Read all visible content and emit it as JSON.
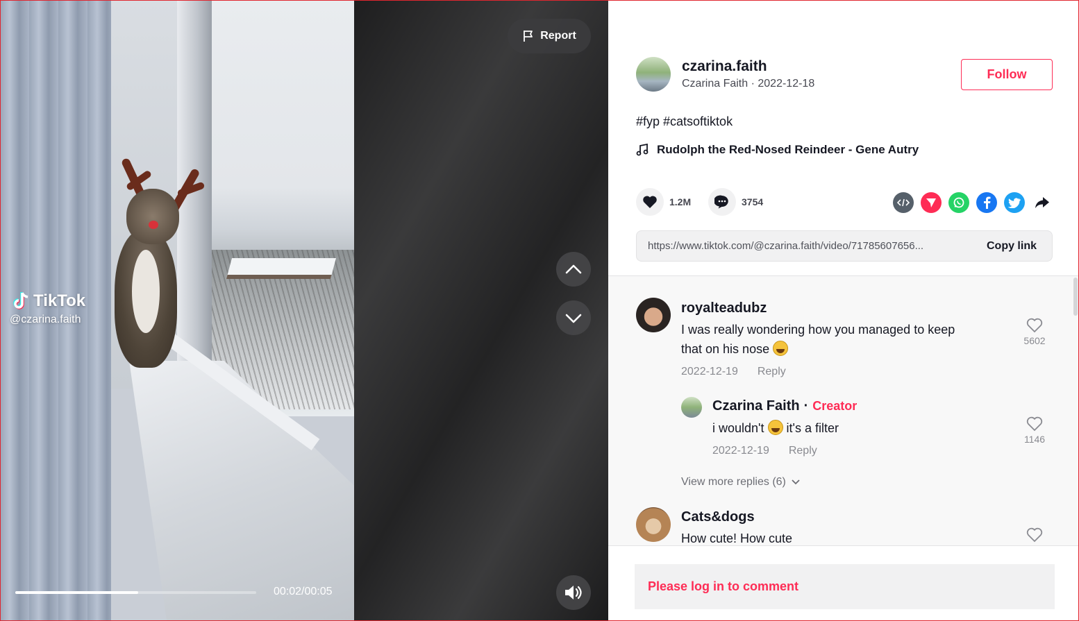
{
  "video": {
    "watermark_brand": "TikTok",
    "watermark_user": "@czarina.faith",
    "time": "00:02/00:05",
    "progress": 0.51
  },
  "controls": {
    "report_label": "Report"
  },
  "author": {
    "username": "czarina.faith",
    "subtitle": "Czarina Faith · 2022-12-18",
    "follow_label": "Follow"
  },
  "post": {
    "description": "#fyp #catsoftiktok",
    "music": "Rudolph the Red-Nosed Reindeer - Gene Autry"
  },
  "stats": {
    "likes": "1.2M",
    "comments": "3754"
  },
  "share": {
    "icons": [
      "embed-icon",
      "send-icon",
      "whatsapp-icon",
      "facebook-icon",
      "twitter-icon",
      "share-arrow-icon"
    ],
    "colors": {
      "embed": "#56606a",
      "send": "#fe2c55",
      "whatsapp": "#25d366",
      "facebook": "#1877f2",
      "twitter": "#1da1f2"
    }
  },
  "link": {
    "url": "https://www.tiktok.com/@czarina.faith/video/71785607656...",
    "copy_label": "Copy link"
  },
  "comments": [
    {
      "name": "royalteadubz",
      "text_a": "I was really wondering how you managed to keep",
      "text_b": "that on his nose",
      "date": "2022-12-19",
      "reply": "Reply",
      "likes": "5602"
    },
    {
      "name": "Czarina Faith",
      "badge": "Creator",
      "text_a": "i wouldn't",
      "text_b": "it's a filter",
      "date": "2022-12-19",
      "reply": "Reply",
      "likes": "1146"
    },
    {
      "name": "Cats&dogs",
      "text_a": "How cute! How cute"
    }
  ],
  "more_replies": "View more replies (6)",
  "login_prompt": "Please log in to comment",
  "colors": {
    "accent": "#fe2c55",
    "text": "#161823"
  }
}
